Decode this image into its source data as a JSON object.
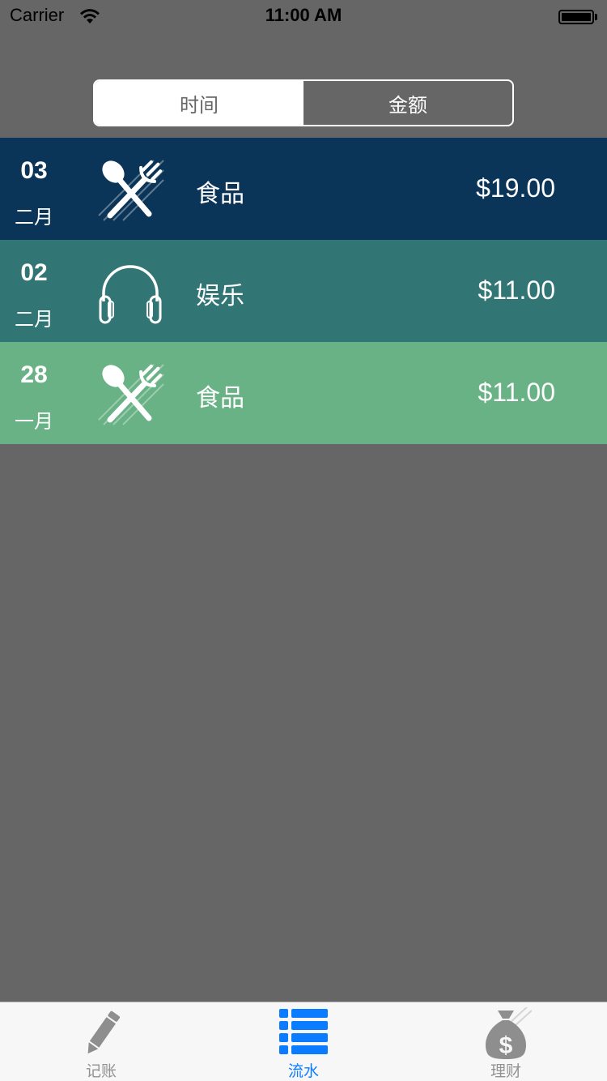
{
  "status_bar": {
    "carrier": "Carrier",
    "time": "11:00 AM"
  },
  "segmented_control": {
    "segments": [
      {
        "label": "时间",
        "selected": true
      },
      {
        "label": "金额",
        "selected": false
      }
    ]
  },
  "records": [
    {
      "day": "03",
      "month": "二月",
      "icon": "fork-spoon-icon",
      "category": "食品",
      "amount": "$19.00",
      "color": "#0b3558"
    },
    {
      "day": "02",
      "month": "二月",
      "icon": "headphones-icon",
      "category": "娱乐",
      "amount": "$11.00",
      "color": "#317674"
    },
    {
      "day": "28",
      "month": "一月",
      "icon": "fork-spoon-icon",
      "category": "食品",
      "amount": "$11.00",
      "color": "#69b285"
    }
  ],
  "tab_bar": {
    "tabs": [
      {
        "label": "记账",
        "icon": "pencil-icon",
        "active": false
      },
      {
        "label": "流水",
        "icon": "list-icon",
        "active": true
      },
      {
        "label": "理财",
        "icon": "money-bag-icon",
        "active": false
      }
    ],
    "active_color": "#0a7cff",
    "inactive_color": "#929292"
  }
}
